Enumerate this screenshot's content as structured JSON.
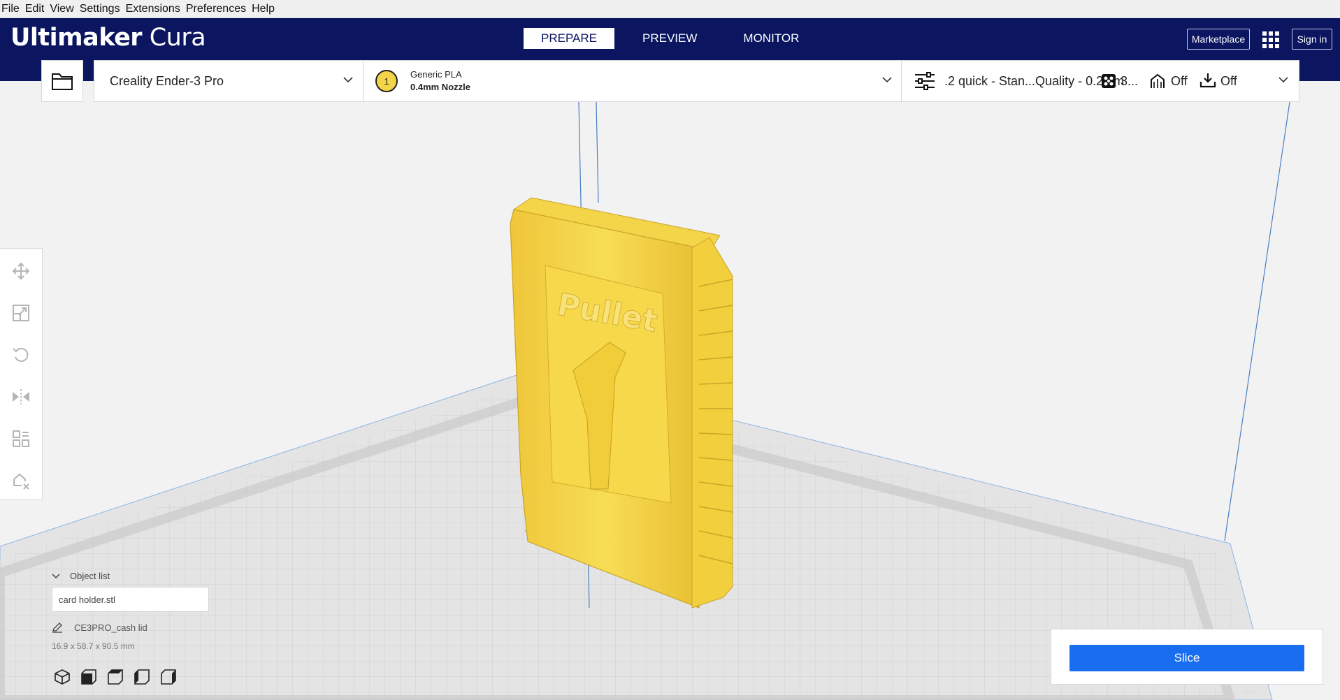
{
  "menu": [
    "File",
    "Edit",
    "View",
    "Settings",
    "Extensions",
    "Preferences",
    "Help"
  ],
  "header": {
    "brand_bold": "Ultimaker",
    "brand_light": "Cura",
    "tabs": [
      "PREPARE",
      "PREVIEW",
      "MONITOR"
    ],
    "active_tab": "PREPARE",
    "marketplace_label": "Marketplace",
    "signin_label": "Sign in"
  },
  "toolbar": {
    "printer": "Creality Ender-3 Pro",
    "extruder_number": "1",
    "material": "Generic PLA",
    "nozzle": "0.4mm Nozzle",
    "profile": ".2 quick - Stan...Quality - 0.2mm",
    "infill": "3...",
    "support": "Off",
    "adhesion": "Off"
  },
  "model": {
    "embossed_text": "Pullet"
  },
  "object_list": {
    "heading": "Object list",
    "file": "card holder.stl",
    "object_name": "CE3PRO_cash lid",
    "dimensions": "16.9 x 58.7 x 90.5 mm"
  },
  "slice": {
    "button_label": "Slice"
  },
  "colors": {
    "header_bg": "#0b1560",
    "accent_blue": "#196ef0",
    "model_yellow": "#f5d94a"
  },
  "icons": [
    "folder-icon",
    "chevron-down-icon",
    "settings-sliders-icon",
    "infill-icon",
    "support-icon",
    "adhesion-icon",
    "move-icon",
    "scale-icon",
    "rotate-icon",
    "mirror-icon",
    "per-model-settings-icon",
    "support-blocker-icon",
    "apps-grid-icon",
    "pencil-icon"
  ]
}
